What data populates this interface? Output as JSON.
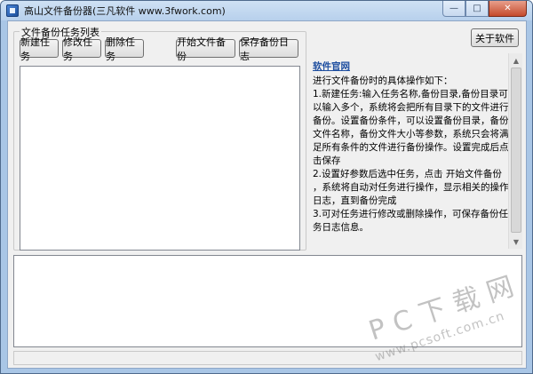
{
  "window": {
    "title": "高山文件备份器(三凡软件 www.3fwork.com)",
    "controls": {
      "minimize": "—",
      "maximize": "□",
      "close": "✕"
    }
  },
  "task_group": {
    "label": "文件备份任务列表",
    "buttons": {
      "new": "新建任务",
      "edit": "修改任务",
      "delete": "删除任务",
      "start": "开始文件备份",
      "save_log": "保存备份日志"
    }
  },
  "about_button": "关于软件",
  "info": {
    "link": "软件官网",
    "lines": [
      "进行文件备份时的具体操作如下：",
      "1.新建任务:输入任务名称,备份目录,备份目录可以输入多个，系统将会把所有目录下的文件进行备份。设置备份条件，可以设置备份目录，备份文件名称，备份文件大小等参数，系统只会将满足所有条件的文件进行备份操作。设置完成后点击保存",
      "2.设置好参数后选中任务，点击 开始文件备份 ，系统将自动对任务进行操作，显示相关的操作日志，直到备份完成",
      "3.可对任务进行修改或删除操作，可保存备份任务日志信息。"
    ]
  },
  "watermark": {
    "brand": "PC下载网",
    "url": "www.pcsoft.com.cn"
  }
}
